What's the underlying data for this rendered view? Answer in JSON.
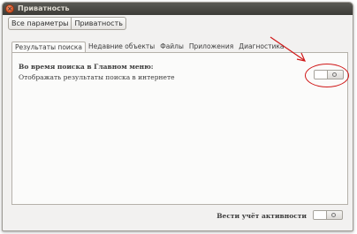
{
  "window": {
    "title": "Приватность",
    "close_glyph": "×"
  },
  "breadcrumb": {
    "items": [
      {
        "label": "Все параметры"
      },
      {
        "label": "Приватность"
      }
    ]
  },
  "tabs": [
    {
      "label": "Результаты поиска",
      "active": true
    },
    {
      "label": "Недавние объекты",
      "active": false
    },
    {
      "label": "Файлы",
      "active": false
    },
    {
      "label": "Приложения",
      "active": false
    },
    {
      "label": "Диагностика",
      "active": false
    }
  ],
  "search_panel": {
    "heading": "Во время поиска в Главном меню:",
    "option_label": "Отображать результаты поиска в интернете",
    "option_state": "off"
  },
  "footer": {
    "activity_label": "Вести учёт активности",
    "activity_state": "off"
  },
  "annotation": {
    "color": "#d01818"
  }
}
